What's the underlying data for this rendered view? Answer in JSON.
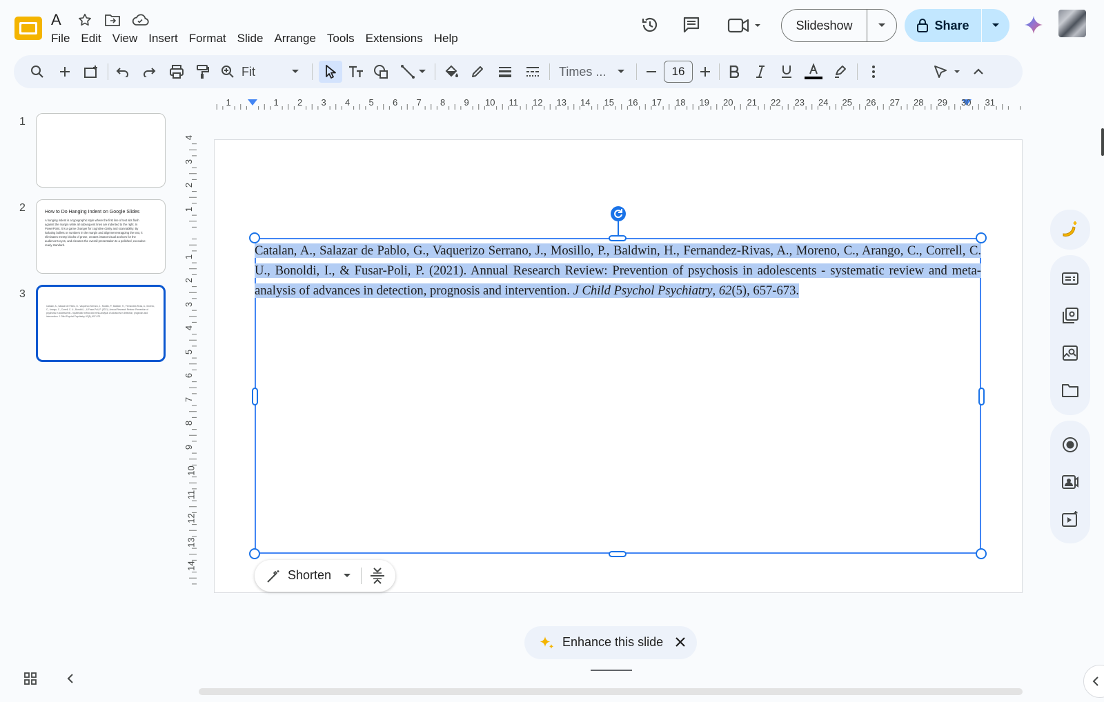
{
  "app": {
    "doc_title": "A",
    "menu": [
      "File",
      "Edit",
      "View",
      "Insert",
      "Format",
      "Slide",
      "Arrange",
      "Tools",
      "Extensions",
      "Help"
    ]
  },
  "header": {
    "slideshow_label": "Slideshow",
    "share_label": "Share"
  },
  "toolbar": {
    "zoom": "Fit",
    "font_name": "Times ...",
    "font_size": "16"
  },
  "filmstrip": {
    "slides": [
      {
        "number": "1",
        "title": "",
        "body": ""
      },
      {
        "number": "2",
        "title": "How to Do Hanging Indent on Google Slides",
        "body": "A hanging indent is a typographic style where the first line of text sits flush against the margin while all subsequent lines are indented to the right. In PowerPoint, it is a game changer for cognitive clarity and scannability. By isolating bullets or numbers in the margin and alignment-wrapping the text, it eliminates messy blocks of prose, creates instant visual anchors for the audience's eyes, and elevates the overall presentation to a polished, executive-ready standard."
      },
      {
        "number": "3",
        "title": "",
        "body": "Catalan, A., Salazar de Pablo, G., Vaquerizo Serrano, J., Mosillo, P., Baldwin, H., Fernandez-Rivas, A., Moreno, C., Arango, C., Correll, C. U., Bonoldi, I., & Fusar-Poli, P. (2021). Annual Research Review: Prevention of psychosis in adolescents - systematic review and meta-analysis of advances in detection, prognosis and intervention. J Child Psychol Psychiatry, 62(5), 657-673."
      }
    ]
  },
  "rulers": {
    "horizontal": [
      "1",
      "1",
      "2",
      "3",
      "4",
      "5",
      "6",
      "7",
      "8",
      "9",
      "10",
      "11",
      "12",
      "13",
      "14",
      "15",
      "16",
      "17",
      "18",
      "19",
      "20",
      "21",
      "22",
      "23",
      "24",
      "25",
      "26",
      "27",
      "28",
      "29",
      "30",
      "31"
    ],
    "vertical_up": [
      "4",
      "3",
      "2",
      "1"
    ],
    "vertical_down": [
      "1",
      "2",
      "3",
      "4",
      "5",
      "6",
      "7",
      "8",
      "9",
      "10",
      "11",
      "12",
      "13",
      "14"
    ]
  },
  "slide": {
    "reference": {
      "part1": "Catalan, A., Salazar de Pablo, G., Vaquerizo Serrano, J., Mosillo, P., Baldwin, H., Fernandez-Rivas, A., Moreno, C., Arango, C., Correll, C. U., Bonoldi, I., & Fusar-Poli, P. (2021). Annual Research Review: Prevention of psychosis in adolescents - systematic review and meta-analysis of advances in detection, prognosis and intervention. ",
      "journal": "J Child Psychol Psychiatry",
      "sep": ", ",
      "volume": "62",
      "part2": "(5), 657-673."
    }
  },
  "ai_chip": {
    "shorten_label": "Shorten"
  },
  "bottom": {
    "enhance_label": "Enhance this slide"
  },
  "colors": {
    "accent": "#0b57d0",
    "selection": "#b3cdf4",
    "share_bg": "#c2e7ff",
    "logo": "#f4b400"
  },
  "icons": [
    "slides-logo-icon",
    "star-icon",
    "move-folder-icon",
    "cloud-saved-icon",
    "history-icon",
    "comments-icon",
    "meet-icon",
    "lock-icon",
    "gemini-icon",
    "search-icon",
    "new-icon",
    "new-slide-icon",
    "undo-icon",
    "redo-icon",
    "print-icon",
    "paint-format-icon",
    "zoom-icon",
    "select-icon",
    "text-box-icon",
    "shape-icon",
    "line-icon",
    "fill-color-icon",
    "border-color-icon",
    "border-weight-icon",
    "border-dash-icon",
    "bold-icon",
    "italic-icon",
    "underline-icon",
    "text-color-icon",
    "highlight-icon",
    "more-icon",
    "mode-icon",
    "collapse-icon",
    "wand-icon",
    "sparkle-icon",
    "close-icon",
    "grid-view-icon"
  ]
}
